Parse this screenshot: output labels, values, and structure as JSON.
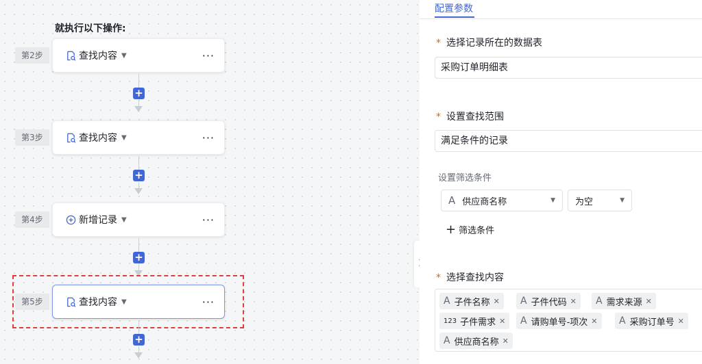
{
  "flow": {
    "title": "就执行以下操作:",
    "steps": [
      {
        "label": "第2步",
        "name": "查找内容",
        "icon": "search-record-icon"
      },
      {
        "label": "第3步",
        "name": "查找内容",
        "icon": "search-record-icon"
      },
      {
        "label": "第4步",
        "name": "新增记录",
        "icon": "add-circle-icon"
      },
      {
        "label": "第5步",
        "name": "查找内容",
        "icon": "search-record-icon"
      }
    ],
    "more_glyph": "···",
    "plus_glyph": "+"
  },
  "panel": {
    "tab": "配置参数",
    "table_label": "选择记录所在的数据表",
    "table_value": "采购订单明细表",
    "range_label": "设置查找范围",
    "range_value": "满足条件的记录",
    "filter_label": "设置筛选条件",
    "filter_field": "供应商名称",
    "filter_operator": "为空",
    "add_filter": "筛选条件",
    "content_label": "选择查找内容",
    "content_tags": [
      {
        "type": "A",
        "label": "子件名称"
      },
      {
        "type": "A",
        "label": "子件代码"
      },
      {
        "type": "A",
        "label": "需求来源"
      },
      {
        "type": "123",
        "label": "子件需求"
      },
      {
        "type": "A",
        "label": "请购单号-项次"
      },
      {
        "type": "A",
        "label": "采购订单号"
      },
      {
        "type": "A",
        "label": "供应商名称"
      }
    ],
    "required_mark": "*",
    "accent_color": "#4266d6",
    "required_color": "#d46b08"
  }
}
